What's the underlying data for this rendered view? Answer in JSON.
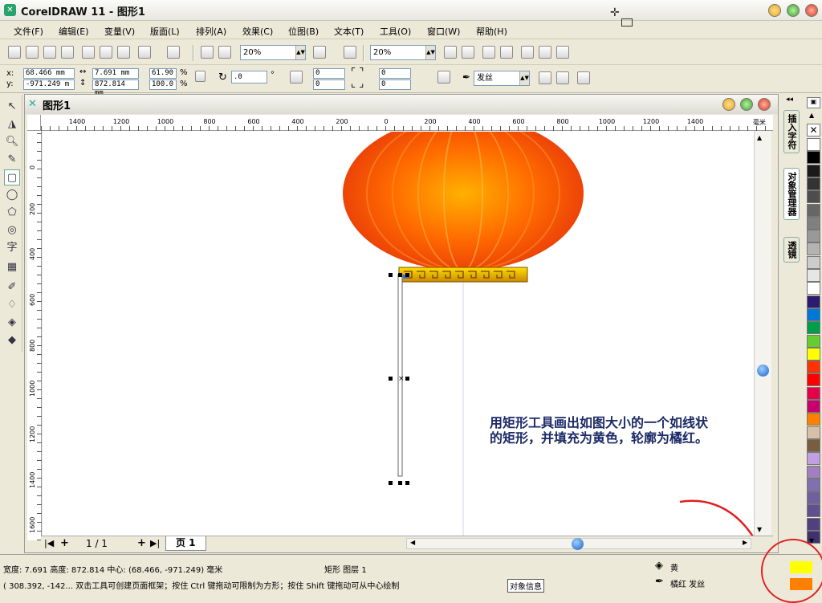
{
  "title": "CorelDRAW 11 - 图形1",
  "menu": [
    "文件(F)",
    "编辑(E)",
    "变量(V)",
    "版面(L)",
    "排列(A)",
    "效果(C)",
    "位图(B)",
    "文本(T)",
    "工具(O)",
    "窗口(W)",
    "帮助(H)"
  ],
  "toolbar": {
    "zoom1": "20%",
    "zoom2": "20%"
  },
  "props": {
    "x_label": "x:",
    "y_label": "y:",
    "x": "68.466 mm",
    "y": "-971.249 m",
    "w": "7.691 mm",
    "h": "872.814 mm",
    "scale_x": "61.90",
    "scale_y": "100.0",
    "pct": "%",
    "angle": ".0",
    "deg": "°",
    "c1": "0",
    "c2": "0",
    "c3": "0",
    "c4": "0",
    "outline": "发丝"
  },
  "doc": {
    "title": "图形1",
    "page_nav": "1 / 1",
    "page_tab": "页 1",
    "ruler_unit": "毫米",
    "vruler_unit": "毫米"
  },
  "hruler_ticks": [
    "1400",
    "1200",
    "1000",
    "800",
    "600",
    "400",
    "200",
    "0",
    "200",
    "400",
    "600",
    "800",
    "1000",
    "1200",
    "1400"
  ],
  "vruler_ticks": [
    "0",
    "200",
    "400",
    "600",
    "800",
    "1000",
    "1200",
    "1400",
    "1600"
  ],
  "dockers": [
    "插入字符",
    "对象管理器",
    "透镜"
  ],
  "annotation": [
    "用矩形工具画出如图大小的一个如线状",
    "的矩形，并填充为黄色，轮廓为橘红。"
  ],
  "status": {
    "dims": "宽度: 7.691  高度: 872.814  中心: (68.466, -971.249)  毫米",
    "obj": "矩形 图层 1",
    "hint": "( 308.392, -142...   双击工具可创建页面框架；按住 Ctrl 键拖动可限制为方形；按住 Shift 键拖动可从中心绘制",
    "info_btn": "对象信息",
    "fill_name": "黄",
    "outline_name": "橘红  发丝",
    "fill_color": "#ffff00",
    "outline_color": "#ff7f00"
  },
  "palette": [
    "#ffffff",
    "#000000",
    "#1a1a1a",
    "#333333",
    "#4d4d4d",
    "#666666",
    "#808080",
    "#999999",
    "#b3b3b3",
    "#cccccc",
    "#e6e6e6",
    "#ffffff",
    "#2e1a6e",
    "#0078d7",
    "#009e49",
    "#66cc33",
    "#ffff00",
    "#ff3300",
    "#ff0000",
    "#e6004c",
    "#c8006e",
    "#ff8000",
    "#d8c0a8",
    "#7a5c3e",
    "#c0a0e0",
    "#a080c0",
    "#8070b0",
    "#7060a0",
    "#605090",
    "#504080",
    "#403070"
  ],
  "icons": {
    "app": "coreldraw-icon",
    "doc": "document-icon"
  }
}
